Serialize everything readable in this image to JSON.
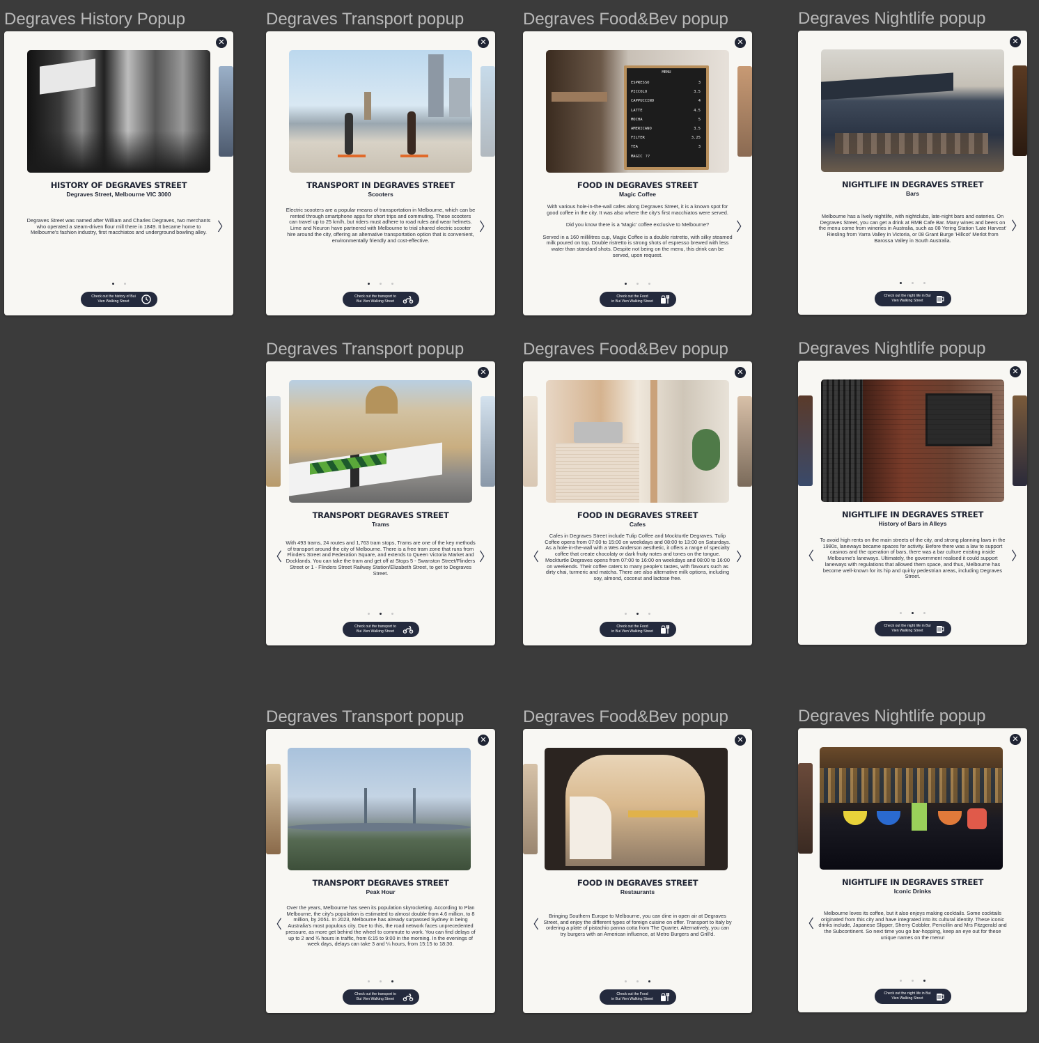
{
  "colors": {
    "canvas": "#3b3b3b",
    "card": "#f8f7f3",
    "navy": "#242a3d",
    "frame_title": "#b9b9b9"
  },
  "frames": [
    {
      "label": "Degraves History Popup"
    },
    {
      "label": "Degraves Transport popup"
    },
    {
      "label": "Degraves Food&Bev popup"
    },
    {
      "label": "Degraves Nightlife popup"
    },
    {
      "label": "Degraves Transport popup"
    },
    {
      "label": "Degraves Food&Bev popup"
    },
    {
      "label": "Degraves Nightlife popup"
    },
    {
      "label": "Degraves Transport popup"
    },
    {
      "label": "Degraves Food&Bev popup"
    },
    {
      "label": "Degraves Nightlife popup"
    }
  ],
  "cards": [
    {
      "close": "✕",
      "title": "HISTORY OF DEGRAVES STREET",
      "subtitle": "Degraves Street, Melbourne VIC 3000",
      "body": "Degraves Street was named after William and Charles Degraves, two merchants who operated a steam-driven flour mill there in 1849. It became home to Melbourne's fashion industry, first macchiatos and underground bowling alley.",
      "cta": "Check out the history of Bui\nVien Walking Street",
      "cta_icon": "clock-icon",
      "prev": "",
      "next": "〉"
    },
    {
      "close": "✕",
      "title": "TRANSPORT IN DEGRAVES STREET",
      "subtitle": "Scooters",
      "body": "Electric scooters are a popular means of transportation in Melbourne, which can be rented through smartphone apps for short trips and commuting. These scooters can travel up to 25 km/h, but riders must adhere to road rules and wear helmets. Lime and Neuron have partnered with Melbourne to trial shared electric scooter hire around the city, offering an alternative transportation option that is convenient, environmentally friendly and cost-effective.",
      "cta": "Check out the transport to\nBui Vien Walking Street",
      "cta_icon": "motorbike-icon",
      "prev": "",
      "next": "〉"
    },
    {
      "close": "✕",
      "title": "FOOD IN DEGRAVES STREET",
      "subtitle": "Magic Coffee",
      "body": "With various hole-in-the-wall cafes along Degraves Street, it is a known spot for good coffee in the city. It was also where the city's first macchiatos were served.\n\nDid you know there is a 'Magic' coffee exclusive to Melbourne?\n\nServed in a 160 millilitres cup, Magic Coffee is a double ristretto, with silky steamed milk poured on top. Double ristretto is strong shots of espresso brewed with less water than standard shots. Despite not being on the menu, this drink can be served, upon request.",
      "cta": "Check out the Food\nin Bui Vien Walking Street",
      "cta_icon": "food-drink-icon",
      "prev": "",
      "next": "〉",
      "menu": {
        "heading": "MENU",
        "items": [
          [
            "ESPRESSO",
            "3"
          ],
          [
            "PICCOLO",
            "3.5"
          ],
          [
            "CAPPUCCINO",
            "4"
          ],
          [
            "LATTE",
            "4.5"
          ],
          [
            "MOCHA",
            "5"
          ],
          [
            "AMERICANO",
            "3.5"
          ],
          [
            "FILTER",
            "3.25"
          ],
          [
            "TEA",
            "3"
          ],
          [
            "MAGIC",
            "??"
          ]
        ]
      }
    },
    {
      "close": "✕",
      "title": "NIGHTLIFE IN DEGRAVES STREET",
      "subtitle": "Bars",
      "body": "Melbourne has a lively nightlife, with nightclubs, late-night bars and eateries. On Degraves Street, you can get a drink at RMB Cafe Bar. Many wines and beers on the menu come from wineries in Australia, such as 08 Yering Station 'Late Harvest' Riesling from Yarra Valley in Victoria, or 08 Grant Burge 'Hillcot' Merlot from Barossa Valley in South Australia.",
      "cta": "Check out the night life in Bui\nVien Walking Street",
      "cta_icon": "beer-icon",
      "prev": "",
      "next": "〉"
    },
    {
      "close": "✕",
      "title": "TRANSPORT DEGRAVES STREET",
      "subtitle": "Trams",
      "body": "With 493 trams, 24 routes and 1,763 tram stops, Trams are one of the key methods of transport around the city of Melbourne. There is a free tram zone that runs from Flinders Street and Federation Square, and extends to Queen Victoria Market and Docklands. You can take the tram and get off at Stops 5 - Swanston Street/Flinders Street or 1 - Flinders Street Railway Station/Elizabeth Street, to get to Degraves Street.",
      "cta": "Check out the transport to\nBui Vien Walking Street",
      "cta_icon": "motorbike-icon",
      "prev": "〈",
      "next": "〉"
    },
    {
      "close": "✕",
      "title": "FOOD IN DEGRAVES STREET",
      "subtitle": "Cafes",
      "body": "Cafes in Degraves Street include Tulip Coffee and Mockturtle Degraves. Tulip Coffee opens from 07:00 to 15:00 on weekdays and 08:00 to 13:00 on Saturdays. As a hole-in-the-wall with a Wes Anderson aesthetic, it offers a range of specialty coffee that create chocolaty or dark fruity notes and tones on the tongue. Mockturtle Degraves opens from 07:00 to 16:00 on weekdays and 08:00 to 16:00 on weekends. Their coffee caters to many people's tastes, with flavours such as dirty chai, turmeric and matcha. There are also alternative milk options, including soy, almond, coconut and lactose free.",
      "cta": "Check out the Food\nin Bui Vien Walking Street",
      "cta_icon": "food-drink-icon",
      "prev": "〈",
      "next": "〉"
    },
    {
      "close": "✕",
      "title": "NIGHTLIFE IN DEGRAVES STREET",
      "subtitle": "History of Bars in Alleys",
      "body": "To avoid high rents on the main streets of the city, and strong planning laws in the 1980s, laneways became spaces for activity. Before there was a law to support casinos and the operation of bars, there was a bar culture existing inside Melbourne's laneways. Ultimately, the government realised it could support laneways with regulations that allowed them space, and thus, Melbourne has become well-known for its hip and quirky pedestrian areas, including Degraves Street.",
      "cta": "Check out the night life in Bui\nVien Walking Street",
      "cta_icon": "beer-icon",
      "prev": "〈",
      "next": "〉"
    },
    {
      "close": "✕",
      "title": "TRANSPORT DEGRAVES STREET",
      "subtitle": "Peak Hour",
      "body": "Over the years, Melbourne has seen its population skyrocketing. According to Plan Melbourne, the city's population is estimated to almost double from 4.6 million, to 8 million, by 2051. In 2023, Melbourne has already surpassed Sydney in being Australia's most populous city. Due to this, the road network faces unprecedented pressure, as more get behind the wheel to commute to work. You can find delays of up to 2 and ¾ hours in traffic, from 6:15 to 9:00 in the morning. In the evenings of week days, delays can take 3 and ¼ hours, from 15:15 to 18:30.",
      "cta": "Check out the transport to\nBui Vien Walking Street",
      "cta_icon": "motorbike-icon",
      "prev": "〈",
      "next": ""
    },
    {
      "close": "✕",
      "title": "FOOD IN DEGRAVES STREET",
      "subtitle": "Restaurants",
      "body": "Bringing Southern Europe to Melbourne, you can dine in open air at Degraves Street, and enjoy the different types of foreign cuisine on offer. Transport to Italy by ordering a plate of pistachio panna cotta from The Quarter. Alternatively, you can try burgers with an American influence, at Metro Burgers and Grill'd.",
      "cta": "Check out the Food\nin Bui Vien Walking Street",
      "cta_icon": "food-drink-icon",
      "prev": "〈",
      "next": ""
    },
    {
      "close": "✕",
      "title": "NIGHTLIFE IN DEGRAVES STREET",
      "subtitle": "Iconic Drinks",
      "body": "Melbourne loves its coffee, but it also enjoys making cocktails. Some cocktails originated from this city and have integrated into its cultural identity. These iconic drinks include, Japanese Slipper, Sherry Cobbler, Penicillin and Mrs Fitzgerald and the Subcontinent. So next time you go bar-hopping, keep an eye out for these unique names on the menu!",
      "cta": "Check out the night life in Bui\nVien Walking Street",
      "cta_icon": "beer-icon",
      "prev": "〈",
      "next": ""
    }
  ]
}
